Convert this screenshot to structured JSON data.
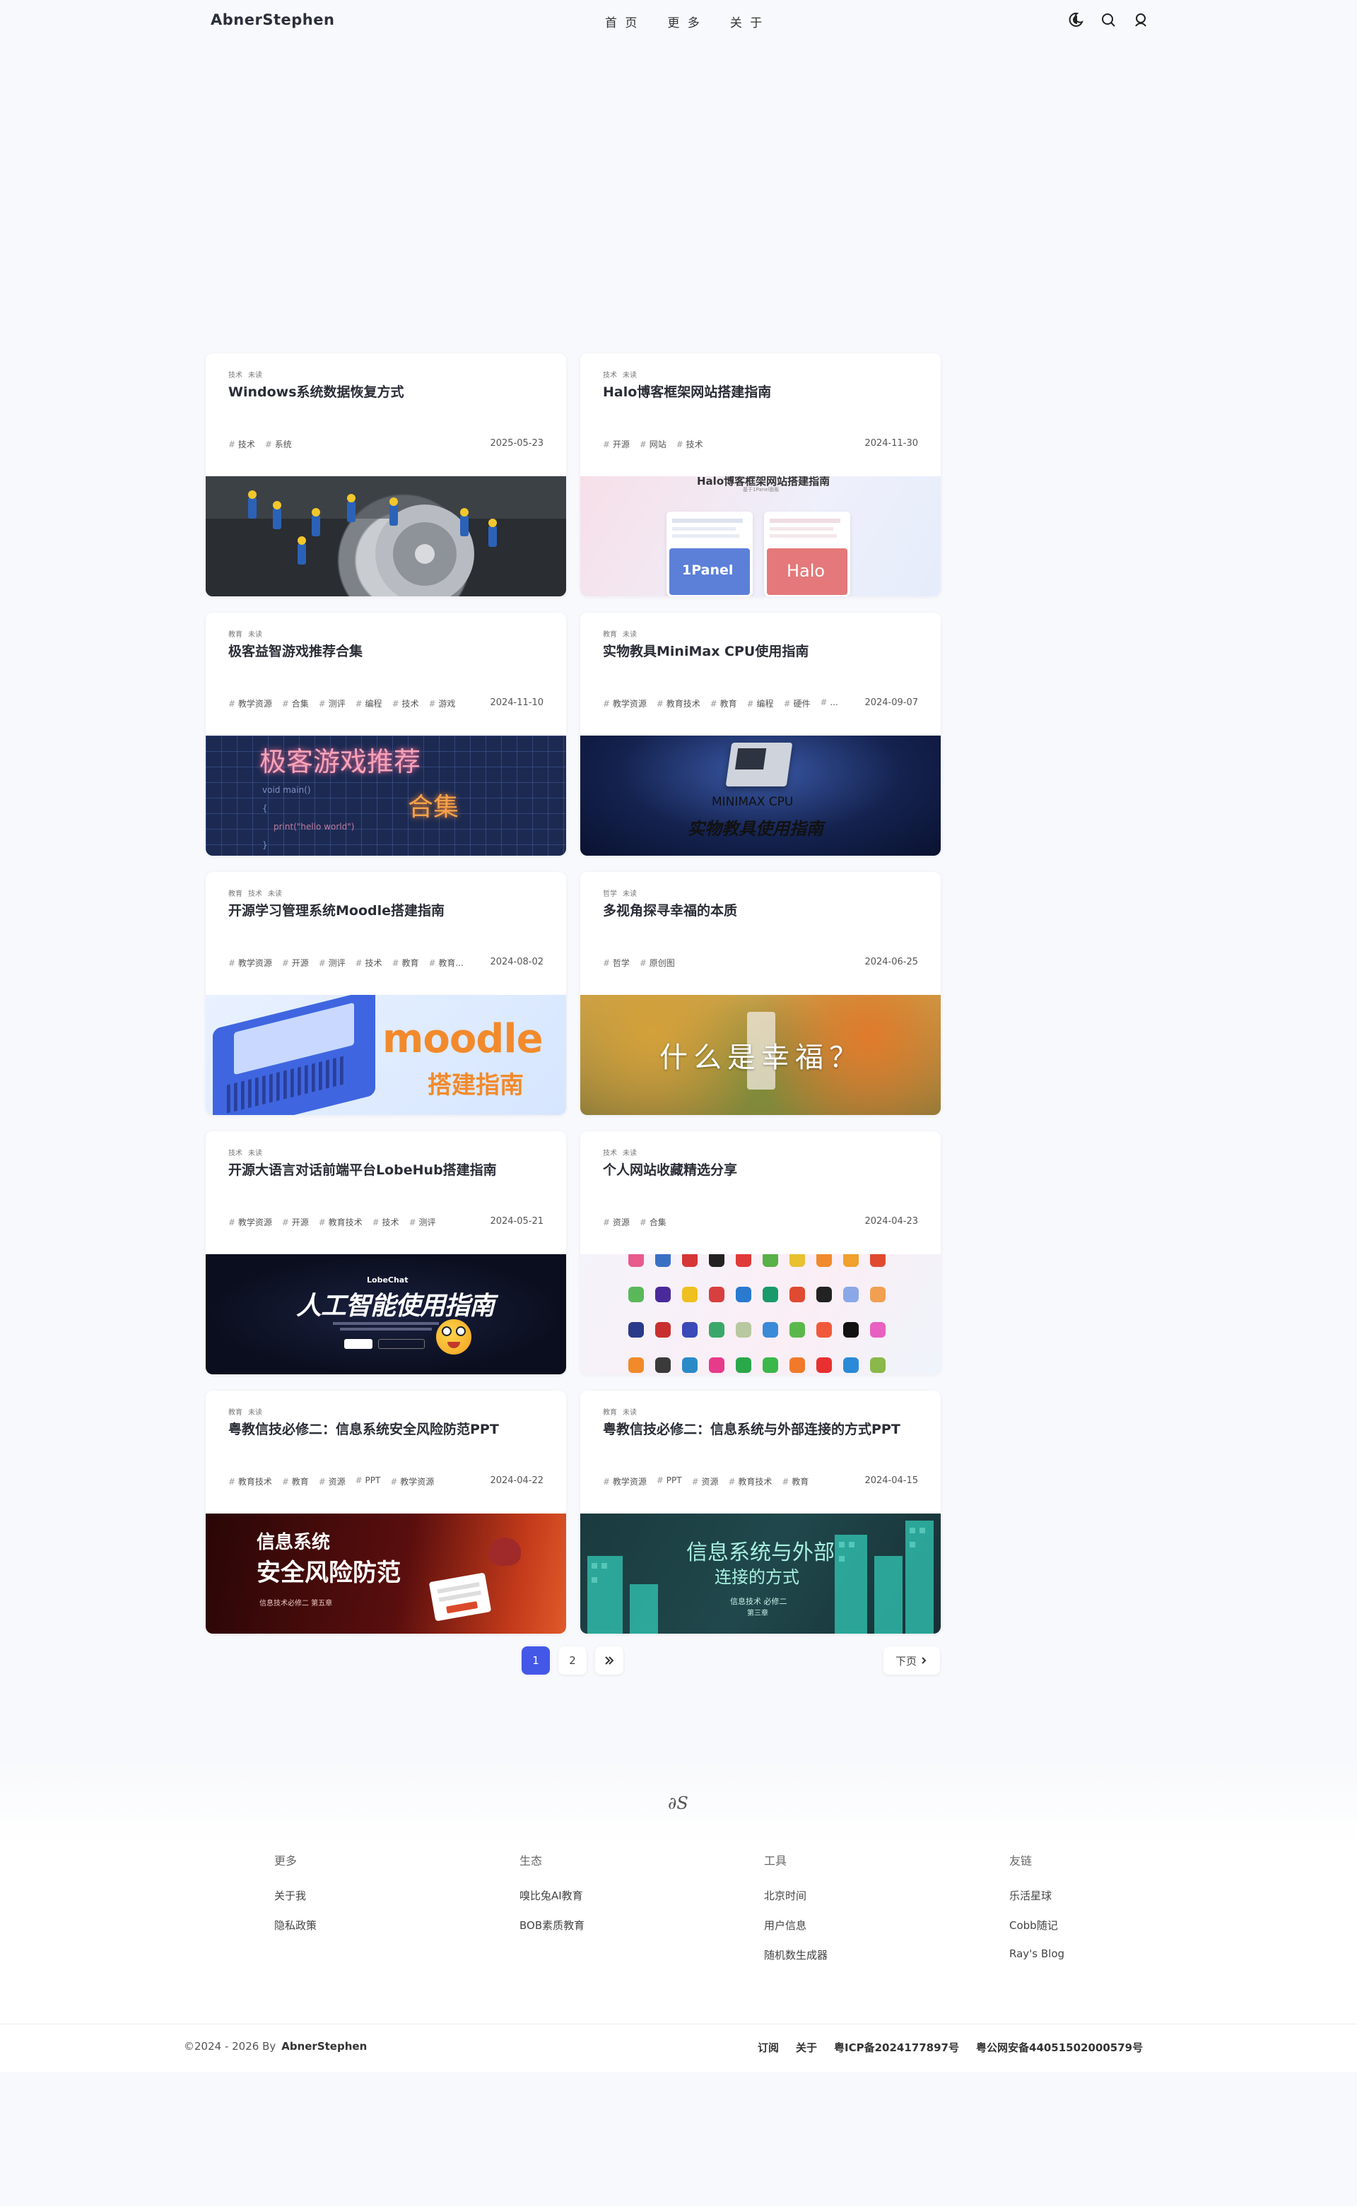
{
  "header": {
    "brand": "AbnerStephen",
    "nav": [
      "首 页",
      "更 多",
      "关 于"
    ]
  },
  "cards": [
    {
      "cats": [
        "技术",
        "未读"
      ],
      "title": "Windows系统数据恢复方式",
      "tags": [
        "技术",
        "系统"
      ],
      "date": "2025-05-23"
    },
    {
      "cats": [
        "技术",
        "未读"
      ],
      "title": "Halo博客框架网站搭建指南",
      "tags": [
        "开源",
        "网站",
        "技术"
      ],
      "date": "2024-11-30",
      "cover_text": "Halo博客框架网站搭建指南",
      "cover_sub": "基于1Panel面板",
      "cover_left": "1Panel",
      "cover_right": "Halo"
    },
    {
      "cats": [
        "教育",
        "未读"
      ],
      "title": "极客益智游戏推荐合集",
      "tags": [
        "教学资源",
        "合集",
        "测评",
        "编程",
        "技术",
        "游戏"
      ],
      "date": "2024-11-10",
      "cover_text": "极客游戏推荐",
      "cover_sub": "合集",
      "cover_code1": "void main()",
      "cover_code2": "{",
      "cover_code3": "print(\"hello world\")",
      "cover_code4": "}"
    },
    {
      "cats": [
        "教育",
        "未读"
      ],
      "title": "实物教具MiniMax CPU使用指南",
      "tags": [
        "教学资源",
        "教育技术",
        "教育",
        "编程",
        "硬件",
        "..."
      ],
      "date": "2024-09-07",
      "cover_text": "MINIMAX CPU",
      "cover_sub": "实物教具使用指南"
    },
    {
      "cats": [
        "教育",
        "技术",
        "未读"
      ],
      "title": "开源学习管理系统Moodle搭建指南",
      "tags": [
        "教学资源",
        "开源",
        "测评",
        "技术",
        "教育",
        "教育..."
      ],
      "date": "2024-08-02",
      "cover_text": "moodle",
      "cover_sub": "搭建指南"
    },
    {
      "cats": [
        "哲学",
        "未读"
      ],
      "title": "多视角探寻幸福的本质",
      "tags": [
        "哲学",
        "原创图"
      ],
      "date": "2024-06-25",
      "cover_text": "什么是幸福？"
    },
    {
      "cats": [
        "技术",
        "未读"
      ],
      "title": "开源大语言对话前端平台LobeHub搭建指南",
      "tags": [
        "教学资源",
        "开源",
        "教育技术",
        "技术",
        "测评"
      ],
      "date": "2024-05-21",
      "cover_label": "LobeChat",
      "cover_text": "人工智能使用指南"
    },
    {
      "cats": [
        "技术",
        "未读"
      ],
      "title": "个人网站收藏精选分享",
      "tags": [
        "资源",
        "合集"
      ],
      "date": "2024-04-23"
    },
    {
      "cats": [
        "教育",
        "未读"
      ],
      "title": "粤教信技必修二：信息系统安全风险防范PPT",
      "tags": [
        "教育技术",
        "教育",
        "资源",
        "PPT",
        "教学资源"
      ],
      "date": "2024-04-22",
      "cover_text": "信息系统",
      "cover_sub": "安全风险防范",
      "cover_foot": "信息技术必修二 第五章"
    },
    {
      "cats": [
        "教育",
        "未读"
      ],
      "title": "粤教信技必修二：信息系统与外部连接的方式PPT",
      "tags": [
        "教学资源",
        "PPT",
        "资源",
        "教育技术",
        "教育"
      ],
      "date": "2024-04-15",
      "cover_text": "信息系统与外部",
      "cover_sub": "连接的方式",
      "cover_foot1": "信息技术 必修二",
      "cover_foot2": "第三章"
    }
  ],
  "pagination": {
    "pages": [
      "1",
      "2"
    ],
    "current": "1",
    "next_icon": "double-chevron-right-icon",
    "next_label": "下页"
  },
  "footer": {
    "logo": "∂S",
    "columns": [
      {
        "heading": "更多",
        "links": [
          "关于我",
          "隐私政策"
        ]
      },
      {
        "heading": "生态",
        "links": [
          "嗅比兔AI教育",
          "BOB素质教育"
        ]
      },
      {
        "heading": "工具",
        "links": [
          "北京时间",
          "用户信息",
          "随机数生成器"
        ]
      },
      {
        "heading": "友链",
        "links": [
          "乐活星球",
          "Cobb随记",
          "Ray's Blog"
        ]
      }
    ],
    "copyright": "©2024 - 2026 By",
    "author": "AbnerStephen",
    "bottom_links": [
      "订阅",
      "关于",
      "粤ICP备2024177897号",
      "粤公网安备44051502000579号"
    ]
  },
  "colors": {
    "accent": "#4458e8",
    "background": "#f8f9fc"
  }
}
